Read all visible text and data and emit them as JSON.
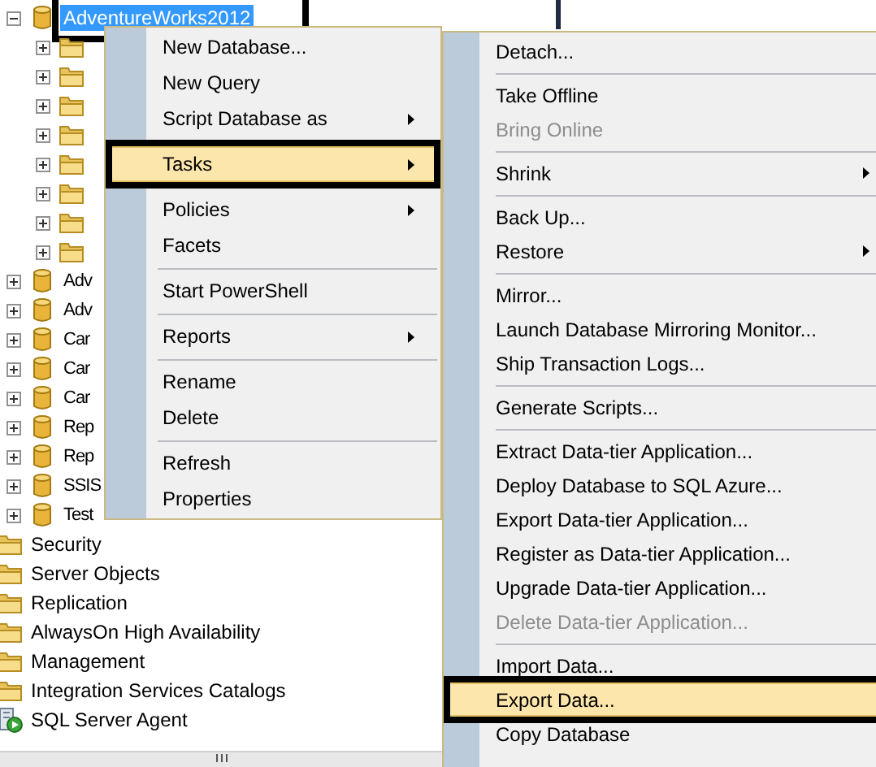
{
  "tree": [
    {
      "label": "AdventureWorks2012",
      "kind": "database",
      "expanded": true,
      "selected": true,
      "outlined": true,
      "children": [
        {
          "kind": "folder",
          "expanded": false
        },
        {
          "kind": "folder",
          "expanded": false
        },
        {
          "kind": "folder",
          "expanded": false
        },
        {
          "kind": "folder",
          "expanded": false
        },
        {
          "kind": "folder",
          "expanded": false
        },
        {
          "kind": "folder",
          "expanded": false
        },
        {
          "kind": "folder",
          "expanded": false
        },
        {
          "kind": "folder",
          "expanded": false
        }
      ]
    },
    {
      "label": "Adv",
      "kind": "database",
      "expanded": false,
      "selected": false,
      "outlined": false
    },
    {
      "label": "Adv",
      "kind": "database",
      "expanded": false,
      "selected": false,
      "outlined": false
    },
    {
      "label": "Car",
      "kind": "database",
      "expanded": false,
      "selected": false,
      "outlined": false
    },
    {
      "label": "Car",
      "kind": "database",
      "expanded": false,
      "selected": false,
      "outlined": false
    },
    {
      "label": "Car",
      "kind": "database",
      "expanded": false,
      "selected": false,
      "outlined": false
    },
    {
      "label": "Rep",
      "kind": "database",
      "expanded": false,
      "selected": false,
      "outlined": false
    },
    {
      "label": "Rep",
      "kind": "database",
      "expanded": false,
      "selected": false,
      "outlined": false
    },
    {
      "label": "SSIS",
      "kind": "database",
      "expanded": false,
      "selected": false,
      "outlined": false
    },
    {
      "label": "Test",
      "kind": "database",
      "expanded": false,
      "selected": false,
      "outlined": false
    }
  ],
  "server_nodes": [
    {
      "label": "Security",
      "kind": "folder"
    },
    {
      "label": "Server Objects",
      "kind": "folder"
    },
    {
      "label": "Replication",
      "kind": "folder"
    },
    {
      "label": "AlwaysOn High Availability",
      "kind": "folder"
    },
    {
      "label": "Management",
      "kind": "folder"
    },
    {
      "label": "Integration Services Catalogs",
      "kind": "folder"
    },
    {
      "label": "SQL Server Agent",
      "kind": "agent"
    }
  ],
  "context_menu": {
    "items": [
      {
        "kind": "item",
        "label": "New Database...",
        "submenu": false,
        "disabled": false,
        "selected": false,
        "outlined": false
      },
      {
        "kind": "item",
        "label": "New Query",
        "submenu": false,
        "disabled": false,
        "selected": false,
        "outlined": false
      },
      {
        "kind": "item",
        "label": "Script Database as",
        "submenu": true,
        "disabled": false,
        "selected": false,
        "outlined": false
      },
      {
        "kind": "separator"
      },
      {
        "kind": "item",
        "label": "Tasks",
        "submenu": true,
        "disabled": false,
        "selected": true,
        "outlined": true
      },
      {
        "kind": "separator"
      },
      {
        "kind": "item",
        "label": "Policies",
        "submenu": true,
        "disabled": false,
        "selected": false,
        "outlined": false
      },
      {
        "kind": "item",
        "label": "Facets",
        "submenu": false,
        "disabled": false,
        "selected": false,
        "outlined": false
      },
      {
        "kind": "separator"
      },
      {
        "kind": "item",
        "label": "Start PowerShell",
        "submenu": false,
        "disabled": false,
        "selected": false,
        "outlined": false
      },
      {
        "kind": "separator"
      },
      {
        "kind": "item",
        "label": "Reports",
        "submenu": true,
        "disabled": false,
        "selected": false,
        "outlined": false
      },
      {
        "kind": "separator"
      },
      {
        "kind": "item",
        "label": "Rename",
        "submenu": false,
        "disabled": false,
        "selected": false,
        "outlined": false
      },
      {
        "kind": "item",
        "label": "Delete",
        "submenu": false,
        "disabled": false,
        "selected": false,
        "outlined": false
      },
      {
        "kind": "separator"
      },
      {
        "kind": "item",
        "label": "Refresh",
        "submenu": false,
        "disabled": false,
        "selected": false,
        "outlined": false
      },
      {
        "kind": "item",
        "label": "Properties",
        "submenu": false,
        "disabled": false,
        "selected": false,
        "outlined": false
      }
    ]
  },
  "tasks_submenu": {
    "items": [
      {
        "kind": "item",
        "label": "Detach...",
        "submenu": false,
        "disabled": false,
        "selected": false,
        "outlined": false
      },
      {
        "kind": "separator"
      },
      {
        "kind": "item",
        "label": "Take Offline",
        "submenu": false,
        "disabled": false,
        "selected": false,
        "outlined": false
      },
      {
        "kind": "item",
        "label": "Bring Online",
        "submenu": false,
        "disabled": true,
        "selected": false,
        "outlined": false
      },
      {
        "kind": "separator"
      },
      {
        "kind": "item",
        "label": "Shrink",
        "submenu": true,
        "disabled": false,
        "selected": false,
        "outlined": false
      },
      {
        "kind": "separator"
      },
      {
        "kind": "item",
        "label": "Back Up...",
        "submenu": false,
        "disabled": false,
        "selected": false,
        "outlined": false
      },
      {
        "kind": "item",
        "label": "Restore",
        "submenu": true,
        "disabled": false,
        "selected": false,
        "outlined": false
      },
      {
        "kind": "separator"
      },
      {
        "kind": "item",
        "label": "Mirror...",
        "submenu": false,
        "disabled": false,
        "selected": false,
        "outlined": false
      },
      {
        "kind": "item",
        "label": "Launch Database Mirroring Monitor...",
        "submenu": false,
        "disabled": false,
        "selected": false,
        "outlined": false
      },
      {
        "kind": "item",
        "label": "Ship Transaction Logs...",
        "submenu": false,
        "disabled": false,
        "selected": false,
        "outlined": false
      },
      {
        "kind": "separator"
      },
      {
        "kind": "item",
        "label": "Generate Scripts...",
        "submenu": false,
        "disabled": false,
        "selected": false,
        "outlined": false
      },
      {
        "kind": "separator"
      },
      {
        "kind": "item",
        "label": "Extract Data-tier Application...",
        "submenu": false,
        "disabled": false,
        "selected": false,
        "outlined": false
      },
      {
        "kind": "item",
        "label": "Deploy Database to SQL Azure...",
        "submenu": false,
        "disabled": false,
        "selected": false,
        "outlined": false
      },
      {
        "kind": "item",
        "label": "Export Data-tier Application...",
        "submenu": false,
        "disabled": false,
        "selected": false,
        "outlined": false
      },
      {
        "kind": "item",
        "label": "Register as Data-tier Application...",
        "submenu": false,
        "disabled": false,
        "selected": false,
        "outlined": false
      },
      {
        "kind": "item",
        "label": "Upgrade Data-tier Application...",
        "submenu": false,
        "disabled": false,
        "selected": false,
        "outlined": false
      },
      {
        "kind": "item",
        "label": "Delete Data-tier Application...",
        "submenu": false,
        "disabled": true,
        "selected": false,
        "outlined": false
      },
      {
        "kind": "separator"
      },
      {
        "kind": "item",
        "label": "Import Data...",
        "submenu": false,
        "disabled": false,
        "selected": false,
        "outlined": false
      },
      {
        "kind": "item",
        "label": "Export Data...",
        "submenu": false,
        "disabled": false,
        "selected": true,
        "outlined": true
      },
      {
        "kind": "item",
        "label": "Copy Database",
        "submenu": false,
        "disabled": false,
        "selected": false,
        "outlined": false
      }
    ]
  }
}
